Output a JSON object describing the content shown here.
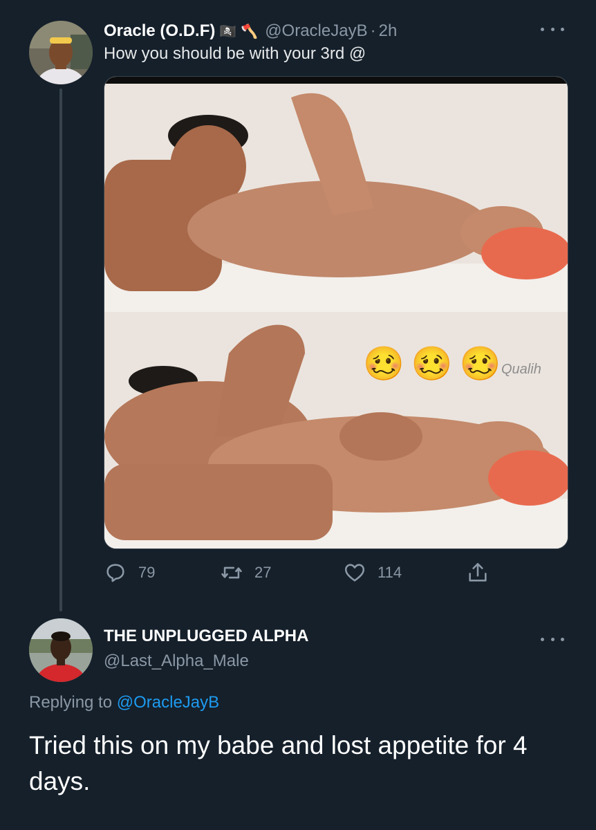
{
  "tweet": {
    "author": {
      "display_name": "Oracle (O.D.F)",
      "badges": [
        "🏴‍☠️",
        "🪓"
      ],
      "handle": "@OracleJayB",
      "separator": "·",
      "time": "2h"
    },
    "text": "How you should be with your 3rd @",
    "media": {
      "watermark": "Qualih",
      "emojis": [
        "🥴",
        "🥴",
        "🥴"
      ]
    },
    "actions": {
      "reply_count": "79",
      "retweet_count": "27",
      "like_count": "114"
    },
    "icons": {
      "more": "more-horizontal-icon",
      "reply": "reply-icon",
      "retweet": "retweet-icon",
      "like": "heart-icon",
      "share": "share-icon"
    }
  },
  "reply": {
    "author": {
      "display_name": "THE UNPLUGGED ALPHA",
      "handle": "@Last_Alpha_Male"
    },
    "replying_label": "Replying to ",
    "replying_to": "@OracleJayB",
    "text": "Tried this on my babe and lost appetite for 4 days."
  },
  "colors": {
    "background": "#15202b",
    "secondary_text": "#8b98a5",
    "link": "#1d9bf0",
    "thread_line": "#38444d"
  }
}
